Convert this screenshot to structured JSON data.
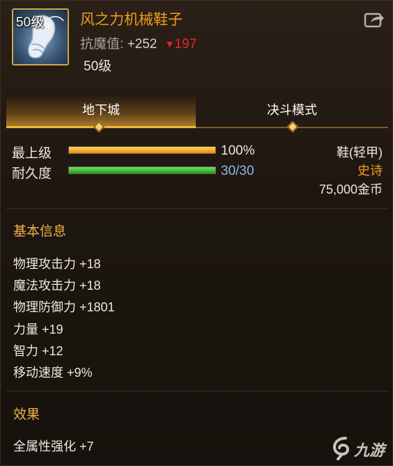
{
  "item": {
    "icon_level": "50级",
    "name": "风之力机械鞋子",
    "resist_label": "抗魔值:",
    "resist_value": "+252",
    "resist_down_symbol": "▼",
    "resist_down": "197",
    "required_level": "50级",
    "icon": "white-boot-icon"
  },
  "share": {
    "icon": "share-icon"
  },
  "tabs": [
    {
      "label": "地下城",
      "active": true
    },
    {
      "label": "决斗模式",
      "active": false
    }
  ],
  "bars": {
    "max_level": {
      "label": "最上级",
      "fraction": 1.0,
      "text": "100%",
      "text_color": "#ece8e0"
    },
    "durability": {
      "label": "耐久度",
      "fraction": 1.0,
      "text": "30/30",
      "text_color": "#8fb8e8"
    }
  },
  "meta": {
    "type": "鞋(轻甲)",
    "rarity": "史诗",
    "rarity_color": "#f29b1f",
    "price": "75,000金币"
  },
  "basic": {
    "title": "基本信息",
    "stats": [
      "物理攻击力 +18",
      "魔法攻击力 +18",
      "物理防御力 +1801",
      "力量 +19",
      "智力 +12",
      "移动速度 +9%"
    ]
  },
  "effect": {
    "title": "效果",
    "lines": [
      "全属性强化 +7"
    ]
  },
  "watermark": {
    "text": "九游"
  },
  "colors": {
    "accent": "#f29b1f",
    "tab_active": "#f0b43a",
    "panel": "#1d1610"
  }
}
